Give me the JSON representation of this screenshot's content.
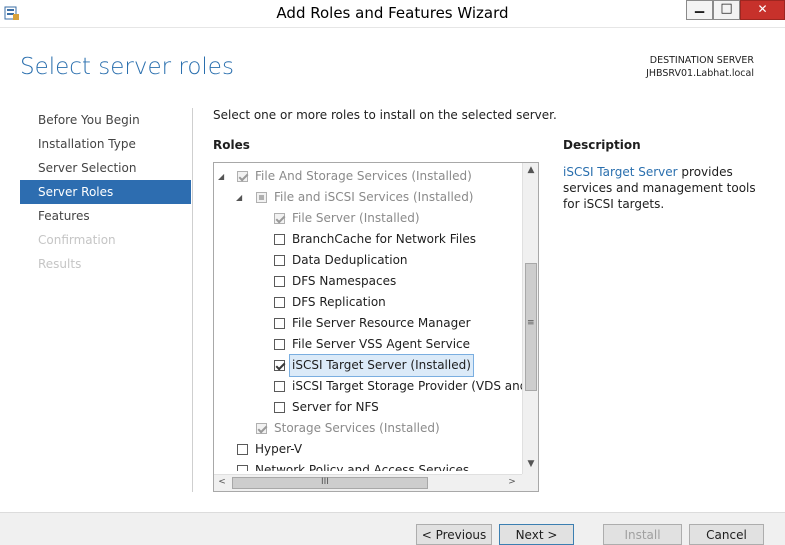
{
  "window": {
    "title": "Add Roles and Features Wizard",
    "min_glyph": "▁",
    "max_glyph": "□",
    "close_glyph": "✕"
  },
  "header": {
    "page_title": "Select server roles",
    "destination_label": "DESTINATION SERVER",
    "destination_server": "JHBSRV01.Labhat.local"
  },
  "nav": {
    "items": [
      {
        "label": "Before You Begin",
        "state": "normal"
      },
      {
        "label": "Installation Type",
        "state": "normal"
      },
      {
        "label": "Server Selection",
        "state": "normal"
      },
      {
        "label": "Server Roles",
        "state": "active"
      },
      {
        "label": "Features",
        "state": "normal"
      },
      {
        "label": "Confirmation",
        "state": "disabled"
      },
      {
        "label": "Results",
        "state": "disabled"
      }
    ]
  },
  "main": {
    "instruction": "Select one or more roles to install on the selected server.",
    "roles_heading": "Roles",
    "description_heading": "Description",
    "description_link": "iSCSI Target Server",
    "description_text": " provides services and management tools for iSCSI targets."
  },
  "roles_tree": [
    {
      "label": "File And Storage Services (Installed)",
      "level": 0,
      "expander": "◢",
      "check": "checked",
      "disabled": true,
      "selected": false
    },
    {
      "label": "File and iSCSI Services (Installed)",
      "level": 1,
      "expander": "◢",
      "check": "partial",
      "disabled": true,
      "selected": false
    },
    {
      "label": "File Server (Installed)",
      "level": 2,
      "expander": "",
      "check": "checked",
      "disabled": true,
      "selected": false
    },
    {
      "label": "BranchCache for Network Files",
      "level": 2,
      "expander": "",
      "check": "unchecked",
      "disabled": false,
      "selected": false
    },
    {
      "label": "Data Deduplication",
      "level": 2,
      "expander": "",
      "check": "unchecked",
      "disabled": false,
      "selected": false
    },
    {
      "label": "DFS Namespaces",
      "level": 2,
      "expander": "",
      "check": "unchecked",
      "disabled": false,
      "selected": false
    },
    {
      "label": "DFS Replication",
      "level": 2,
      "expander": "",
      "check": "unchecked",
      "disabled": false,
      "selected": false
    },
    {
      "label": "File Server Resource Manager",
      "level": 2,
      "expander": "",
      "check": "unchecked",
      "disabled": false,
      "selected": false
    },
    {
      "label": "File Server VSS Agent Service",
      "level": 2,
      "expander": "",
      "check": "unchecked",
      "disabled": false,
      "selected": false
    },
    {
      "label": "iSCSI Target Server (Installed)",
      "level": 2,
      "expander": "",
      "check": "checked",
      "disabled": false,
      "selected": true
    },
    {
      "label": "iSCSI Target Storage Provider (VDS and VSS",
      "level": 2,
      "expander": "",
      "check": "unchecked",
      "disabled": false,
      "selected": false
    },
    {
      "label": "Server for NFS",
      "level": 2,
      "expander": "",
      "check": "unchecked",
      "disabled": false,
      "selected": false
    },
    {
      "label": "Storage Services (Installed)",
      "level": 1,
      "expander": "",
      "check": "checked",
      "disabled": true,
      "selected": false
    },
    {
      "label": "Hyper-V",
      "level": 0,
      "expander": "",
      "check": "unchecked",
      "disabled": false,
      "selected": false
    },
    {
      "label": "Network Policy and Access Services",
      "level": 0,
      "expander": "",
      "check": "unchecked",
      "disabled": false,
      "selected": false
    }
  ],
  "scrollbars": {
    "up": "▲",
    "down": "▼",
    "left": "<",
    "right": ">",
    "v_grip": "≡",
    "h_grip": "III"
  },
  "footer": {
    "previous": "< Previous",
    "next": "Next >",
    "install": "Install",
    "cancel": "Cancel"
  }
}
